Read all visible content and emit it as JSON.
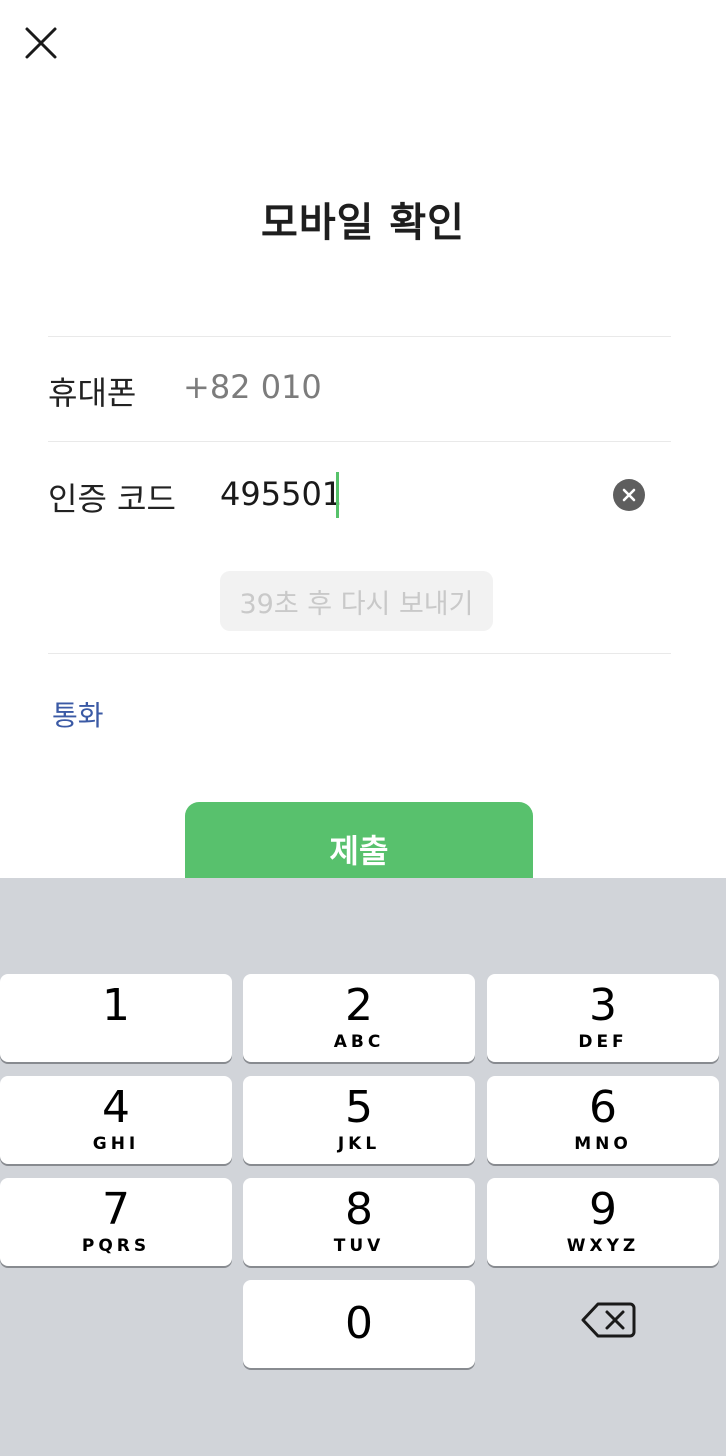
{
  "header": {
    "close_icon": "close-icon",
    "title": "모바일 확인"
  },
  "form": {
    "phone_label": "휴대폰",
    "phone_value": "+82 010",
    "code_label": "인증 코드",
    "code_value": "495501",
    "clear_icon": "clear-circle-icon",
    "resend_label": "39초 후 다시 보내기",
    "call_link": "통화",
    "submit_label": "제출"
  },
  "colors": {
    "accent_green": "#58c16d",
    "link_blue": "#3b5aa5",
    "keyboard_bg": "#d1d4d9"
  },
  "keyboard": {
    "keys": [
      {
        "digit": "1",
        "letters": ""
      },
      {
        "digit": "2",
        "letters": "ABC"
      },
      {
        "digit": "3",
        "letters": "DEF"
      },
      {
        "digit": "4",
        "letters": "GHI"
      },
      {
        "digit": "5",
        "letters": "JKL"
      },
      {
        "digit": "6",
        "letters": "MNO"
      },
      {
        "digit": "7",
        "letters": "PQRS"
      },
      {
        "digit": "8",
        "letters": "TUV"
      },
      {
        "digit": "9",
        "letters": "WXYZ"
      },
      {
        "digit": "0",
        "letters": ""
      }
    ],
    "delete_icon": "backspace-icon"
  }
}
